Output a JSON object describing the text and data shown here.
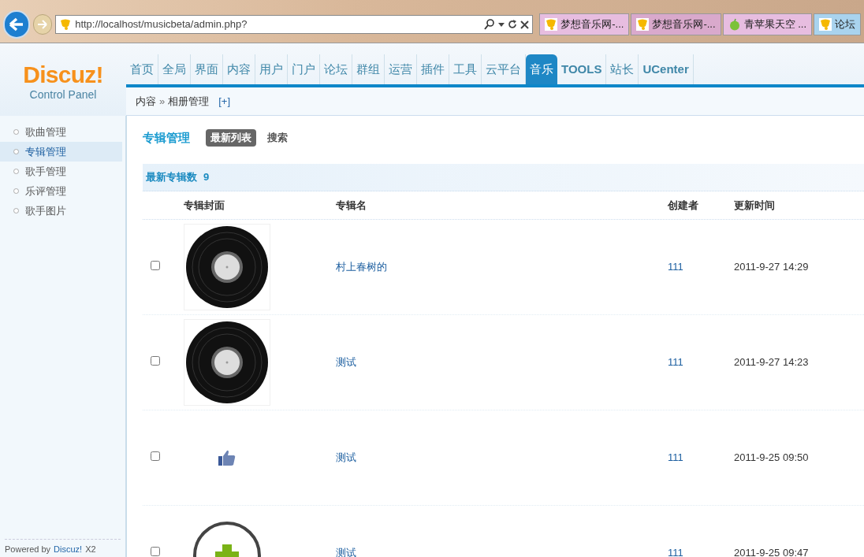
{
  "browser": {
    "url": "http://localhost/musicbeta/admin.php?",
    "tabs": [
      {
        "title": "梦想音乐网-...",
        "kind": "bell",
        "selected": false
      },
      {
        "title": "梦想音乐网-...",
        "kind": "bell",
        "selected": true
      },
      {
        "title": "青苹果天空 ...",
        "kind": "apple",
        "selected": false
      },
      {
        "title": "论坛",
        "kind": "bell",
        "selected": false
      }
    ]
  },
  "logo": {
    "name": "Discuz!",
    "subtitle": "Control Panel"
  },
  "nav": [
    {
      "label": "首页",
      "selected": false
    },
    {
      "label": "全局",
      "selected": false
    },
    {
      "label": "界面",
      "selected": false
    },
    {
      "label": "内容",
      "selected": false
    },
    {
      "label": "用户",
      "selected": false
    },
    {
      "label": "门户",
      "selected": false
    },
    {
      "label": "论坛",
      "selected": false
    },
    {
      "label": "群组",
      "selected": false
    },
    {
      "label": "运营",
      "selected": false
    },
    {
      "label": "插件",
      "selected": false
    },
    {
      "label": "工具",
      "selected": false
    },
    {
      "label": "云平台",
      "selected": false
    },
    {
      "label": "音乐",
      "selected": true
    },
    {
      "label": "TOOLS",
      "selected": false
    },
    {
      "label": "站长",
      "selected": false
    },
    {
      "label": "UCenter",
      "selected": false
    }
  ],
  "breadcrumb": {
    "items": [
      "内容",
      "相册管理"
    ],
    "separator": "»",
    "add": "[+]"
  },
  "sidebar": {
    "items": [
      {
        "label": "歌曲管理",
        "selected": false
      },
      {
        "label": "专辑管理",
        "selected": true
      },
      {
        "label": "歌手管理",
        "selected": false
      },
      {
        "label": "乐评管理",
        "selected": false
      },
      {
        "label": "歌手图片",
        "selected": false
      }
    ],
    "footer": {
      "prefix": "Powered by",
      "link": "Discuz!",
      "suffix": "X2"
    }
  },
  "page": {
    "title": "专辑管理",
    "subtabs": [
      {
        "label": "最新列表",
        "selected": true
      },
      {
        "label": "搜索",
        "selected": false
      }
    ]
  },
  "table": {
    "caption": "最新专辑数",
    "count": "9",
    "columns": [
      "专辑封面",
      "专辑名",
      "创建者",
      "更新时间"
    ],
    "rows": [
      {
        "checked": false,
        "kind": "vinyl",
        "name": "村上春树的",
        "creator": "111",
        "updated": "2011-9-27 14:29"
      },
      {
        "checked": false,
        "kind": "vinyl",
        "name": "测试",
        "creator": "111",
        "updated": "2011-9-27 14:23"
      },
      {
        "checked": false,
        "kind": "thumb",
        "name": "测试",
        "creator": "111",
        "updated": "2011-9-25 09:50"
      },
      {
        "checked": false,
        "kind": "plus",
        "name": "测试",
        "creator": "111",
        "updated": "2011-9-25 09:47"
      }
    ]
  }
}
